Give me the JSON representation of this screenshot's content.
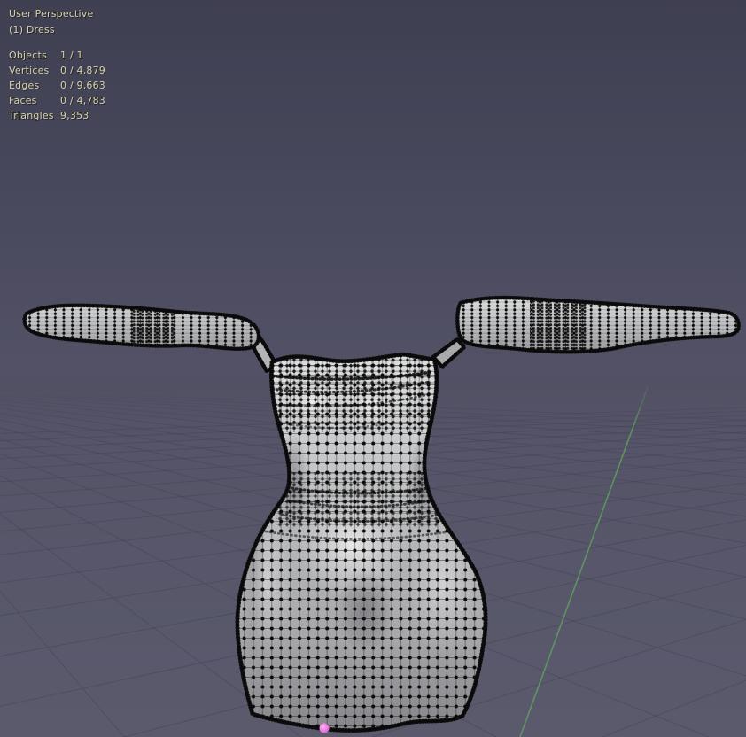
{
  "viewport": {
    "header": {
      "view_label": "User Perspective",
      "object_label": "(1) Dress"
    },
    "stats": {
      "rows": [
        {
          "label": "Objects",
          "value": "1 / 1"
        },
        {
          "label": "Vertices",
          "value": "0 / 4,879"
        },
        {
          "label": "Edges",
          "value": "0 / 9,663"
        },
        {
          "label": "Faces",
          "value": "0 / 4,783"
        },
        {
          "label": "Triangles",
          "value": "9,353"
        }
      ]
    },
    "colors": {
      "bg_top": "#3f3f52",
      "bg_mid1": "#4a4a5e",
      "bg_mid2": "#545367",
      "bg_bottom": "#5b5a6d",
      "grid_line": "#454458",
      "axis_y_green": "#5fa45e",
      "origin_pink": "#ee7fe5",
      "overlay_text": "#d8d2a8",
      "cloth_light": "#dfe0e1",
      "cloth_mid": "#b9babc",
      "cloth_dark": "#97979b",
      "wireframe": "#0b0b0b"
    }
  }
}
